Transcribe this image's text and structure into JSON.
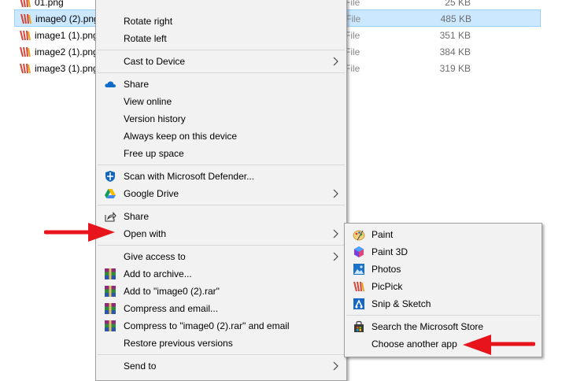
{
  "files": [
    {
      "name": "01.png",
      "type": "File",
      "size": "25 KB",
      "selected": false
    },
    {
      "name": "image0 (2).png",
      "type": "File",
      "size": "485 KB",
      "selected": true
    },
    {
      "name": "image1 (1).png",
      "type": "File",
      "size": "351 KB",
      "selected": false
    },
    {
      "name": "image2 (1).png",
      "type": "File",
      "size": "384 KB",
      "selected": false
    },
    {
      "name": "image3 (1).png",
      "type": "File",
      "size": "319 KB",
      "selected": false
    }
  ],
  "context_menu": {
    "items": [
      {
        "label": "Rotate right"
      },
      {
        "label": "Rotate left"
      },
      {
        "label": "Cast to Device"
      },
      {
        "label": "Share",
        "icon": "onedrive-cloud-icon"
      },
      {
        "label": "View online"
      },
      {
        "label": "Version history"
      },
      {
        "label": "Always keep on this device"
      },
      {
        "label": "Free up space"
      },
      {
        "label": "Scan with Microsoft Defender...",
        "icon": "defender-shield-icon"
      },
      {
        "label": "Google Drive",
        "icon": "google-drive-icon"
      },
      {
        "label": "Share",
        "icon": "share-icon"
      },
      {
        "label": "Open with"
      },
      {
        "label": "Give access to"
      },
      {
        "label": "Add to archive...",
        "icon": "winrar-icon"
      },
      {
        "label": "Add to \"image0 (2).rar\"",
        "icon": "winrar-icon"
      },
      {
        "label": "Compress and email...",
        "icon": "winrar-icon"
      },
      {
        "label": "Compress to \"image0 (2).rar\" and email",
        "icon": "winrar-icon"
      },
      {
        "label": "Restore previous versions"
      },
      {
        "label": "Send to"
      }
    ]
  },
  "open_with_submenu": {
    "items": [
      {
        "label": "Paint",
        "icon": "paint-icon"
      },
      {
        "label": "Paint 3D",
        "icon": "paint-3d-icon"
      },
      {
        "label": "Photos",
        "icon": "photos-icon"
      },
      {
        "label": "PicPick",
        "icon": "picpick-icon"
      },
      {
        "label": "Snip & Sketch",
        "icon": "snip-sketch-icon"
      },
      {
        "label": "Search the Microsoft Store",
        "icon": "store-bag-icon"
      },
      {
        "label": "Choose another app"
      }
    ]
  },
  "colors": {
    "annotation_arrow": "#e8141b",
    "selection_bg": "#cce8ff",
    "menu_bg": "#f2f2f2"
  }
}
